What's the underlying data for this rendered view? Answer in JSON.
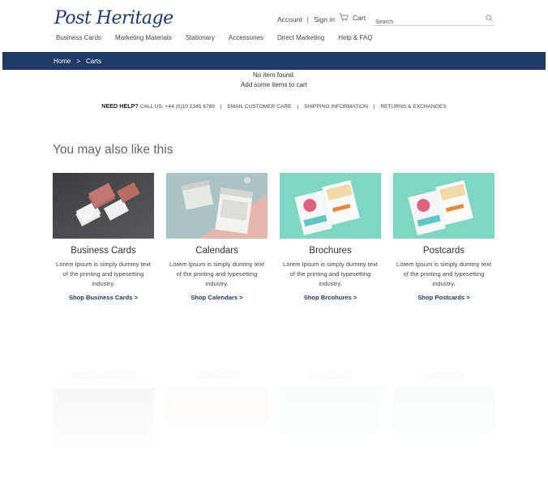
{
  "brand": {
    "name": "Post Heritage"
  },
  "header": {
    "account_label": "Account",
    "signin_label": "Sign in",
    "cart_label": "Cart",
    "search_placeholder": "Search"
  },
  "nav": {
    "items": [
      {
        "label": "Business Cards"
      },
      {
        "label": "Marketing Materials"
      },
      {
        "label": "Stationary"
      },
      {
        "label": "Accessories"
      },
      {
        "label": "Direct Marketing"
      },
      {
        "label": "Help & FAQ"
      }
    ]
  },
  "breadcrumb": {
    "home": "Home",
    "separator": ">",
    "current": "Carts"
  },
  "cart": {
    "empty_line1": "No item found.",
    "empty_line2": "Add some items to cart"
  },
  "help_bar": {
    "need_help": "NEED HELP?",
    "call_us": "CALL US: +44 (0)10 2345 6789",
    "customer_care": "EMAIL CUSTOMER CARE",
    "shipping": "SHIPPING INFORMATION",
    "returns": "RETURNS & EXCHANGES"
  },
  "recommendations": {
    "title": "You may also like this",
    "products": [
      {
        "title": "Business Cards",
        "desc": "Lorem Ipsum is simply dummy text of the printing and typesetting industry.",
        "cta": "Shop Business Cards >"
      },
      {
        "title": "Calendars",
        "desc": "Lorem Ipsum is simply dummy text of the printing and typesetting industry.",
        "cta": "Shop Calendars >"
      },
      {
        "title": "Brochures",
        "desc": "Lorem Ipsum is simply dummy text of the printing and typesetting industry.",
        "cta": "Shop Brcohures >"
      },
      {
        "title": "Postcards",
        "desc": "Lorem Ipsum is simply dummy text of the printing and typesetting industry.",
        "cta": "Shop Postcards >"
      }
    ]
  },
  "colors": {
    "brand_navy": "#1f3a68",
    "mint": "#7fd6c4",
    "rose": "#b8706a"
  }
}
